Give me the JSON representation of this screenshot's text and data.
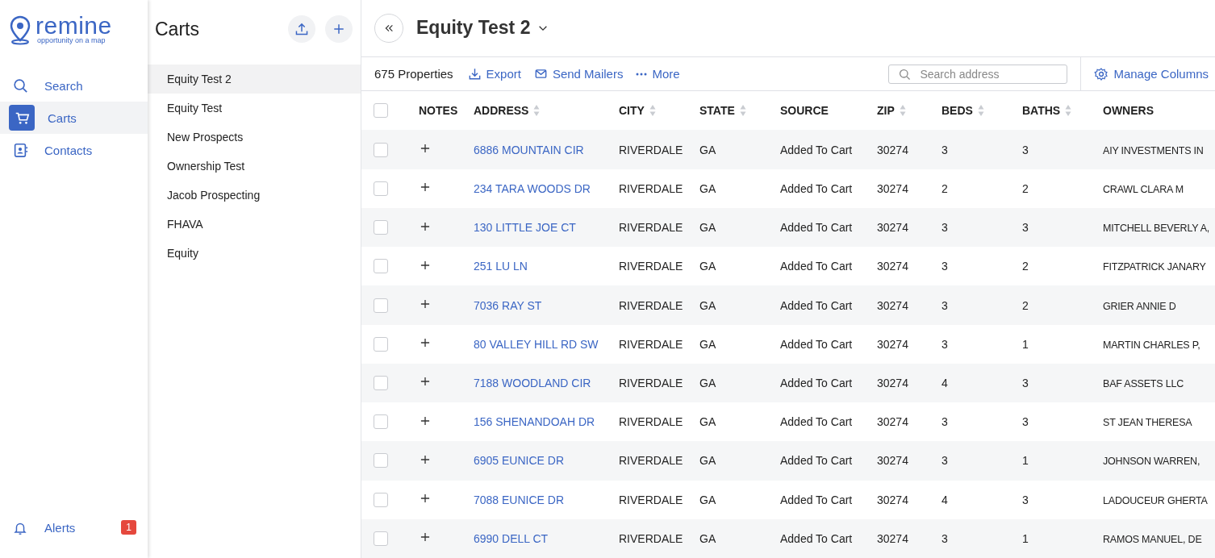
{
  "logo": {
    "name": "remine",
    "tagline": "opportunity on a map"
  },
  "nav": {
    "items": [
      {
        "label": "Search",
        "selected": false
      },
      {
        "label": "Carts",
        "selected": true
      },
      {
        "label": "Contacts",
        "selected": false
      }
    ],
    "alerts": {
      "label": "Alerts",
      "badge": "1"
    }
  },
  "carts_panel": {
    "title": "Carts",
    "items": [
      {
        "label": "Equity Test 2",
        "selected": true
      },
      {
        "label": "Equity Test",
        "selected": false
      },
      {
        "label": "New Prospects",
        "selected": false
      },
      {
        "label": "Ownership Test",
        "selected": false
      },
      {
        "label": "Jacob Prospecting",
        "selected": false
      },
      {
        "label": "FHAVA",
        "selected": false
      },
      {
        "label": "Equity",
        "selected": false
      }
    ]
  },
  "header": {
    "title": "Equity Test 2"
  },
  "toolbar": {
    "count": "675 Properties",
    "actions": [
      {
        "label": "Export"
      },
      {
        "label": "Send Mailers"
      },
      {
        "label": "More"
      }
    ],
    "search": {
      "placeholder": "Search address"
    },
    "manage": "Manage Columns"
  },
  "table": {
    "select_all_checked": false,
    "columns": [
      {
        "label": "NOTES",
        "sortable": false
      },
      {
        "label": "ADDRESS",
        "sortable": true
      },
      {
        "label": "CITY",
        "sortable": true
      },
      {
        "label": "STATE",
        "sortable": true
      },
      {
        "label": "SOURCE",
        "sortable": false
      },
      {
        "label": "ZIP",
        "sortable": true
      },
      {
        "label": "BEDS",
        "sortable": true
      },
      {
        "label": "BATHS",
        "sortable": true
      },
      {
        "label": "OWNERS",
        "sortable": false
      }
    ],
    "rows": [
      {
        "checked": false,
        "address": "6886 MOUNTAIN CIR",
        "city": "RIVERDALE",
        "state": "GA",
        "source": "Added To Cart",
        "zip": "30274",
        "beds": "3",
        "baths": "3",
        "owners": "AIY INVESTMENTS IN"
      },
      {
        "checked": false,
        "address": "234 TARA WOODS DR",
        "city": "RIVERDALE",
        "state": "GA",
        "source": "Added To Cart",
        "zip": "30274",
        "beds": "2",
        "baths": "2",
        "owners": "CRAWL CLARA M"
      },
      {
        "checked": false,
        "address": "130 LITTLE JOE CT",
        "city": "RIVERDALE",
        "state": "GA",
        "source": "Added To Cart",
        "zip": "30274",
        "beds": "3",
        "baths": "3",
        "owners": "MITCHELL BEVERLY A,"
      },
      {
        "checked": false,
        "address": "251 LU LN",
        "city": "RIVERDALE",
        "state": "GA",
        "source": "Added To Cart",
        "zip": "30274",
        "beds": "3",
        "baths": "2",
        "owners": "FITZPATRICK JANARY"
      },
      {
        "checked": false,
        "address": "7036 RAY ST",
        "city": "RIVERDALE",
        "state": "GA",
        "source": "Added To Cart",
        "zip": "30274",
        "beds": "3",
        "baths": "2",
        "owners": "GRIER ANNIE D"
      },
      {
        "checked": false,
        "address": "80 VALLEY HILL RD SW",
        "city": "RIVERDALE",
        "state": "GA",
        "source": "Added To Cart",
        "zip": "30274",
        "beds": "3",
        "baths": "1",
        "owners": "MARTIN CHARLES P,"
      },
      {
        "checked": false,
        "address": "7188 WOODLAND CIR",
        "city": "RIVERDALE",
        "state": "GA",
        "source": "Added To Cart",
        "zip": "30274",
        "beds": "4",
        "baths": "3",
        "owners": "BAF ASSETS LLC"
      },
      {
        "checked": false,
        "address": "156 SHENANDOAH DR",
        "city": "RIVERDALE",
        "state": "GA",
        "source": "Added To Cart",
        "zip": "30274",
        "beds": "3",
        "baths": "3",
        "owners": "ST JEAN THERESA"
      },
      {
        "checked": false,
        "address": "6905 EUNICE DR",
        "city": "RIVERDALE",
        "state": "GA",
        "source": "Added To Cart",
        "zip": "30274",
        "beds": "3",
        "baths": "1",
        "owners": "JOHNSON WARREN,"
      },
      {
        "checked": false,
        "address": "7088 EUNICE DR",
        "city": "RIVERDALE",
        "state": "GA",
        "source": "Added To Cart",
        "zip": "30274",
        "beds": "4",
        "baths": "3",
        "owners": "LADOUCEUR GHERTA"
      },
      {
        "checked": false,
        "address": "6990 DELL CT",
        "city": "RIVERDALE",
        "state": "GA",
        "source": "Added To Cart",
        "zip": "30274",
        "beds": "3",
        "baths": "1",
        "owners": "RAMOS MANUEL, DE"
      }
    ]
  }
}
